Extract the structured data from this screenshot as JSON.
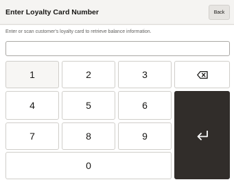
{
  "header": {
    "title": "Enter Loyalty Card Number",
    "back_label": "Back"
  },
  "instruction": "Enter or scan customer's loyalty card to retrieve balance information.",
  "card_input": {
    "value": "",
    "placeholder": ""
  },
  "keypad": {
    "keys": [
      "1",
      "2",
      "3",
      "4",
      "5",
      "6",
      "7",
      "8",
      "9",
      "0"
    ],
    "backspace_icon": "backspace-icon",
    "enter_icon": "enter-return-icon"
  },
  "colors": {
    "header_bg": "#f5f4f2",
    "enter_key_bg": "#312d2a",
    "text": "#161513"
  }
}
